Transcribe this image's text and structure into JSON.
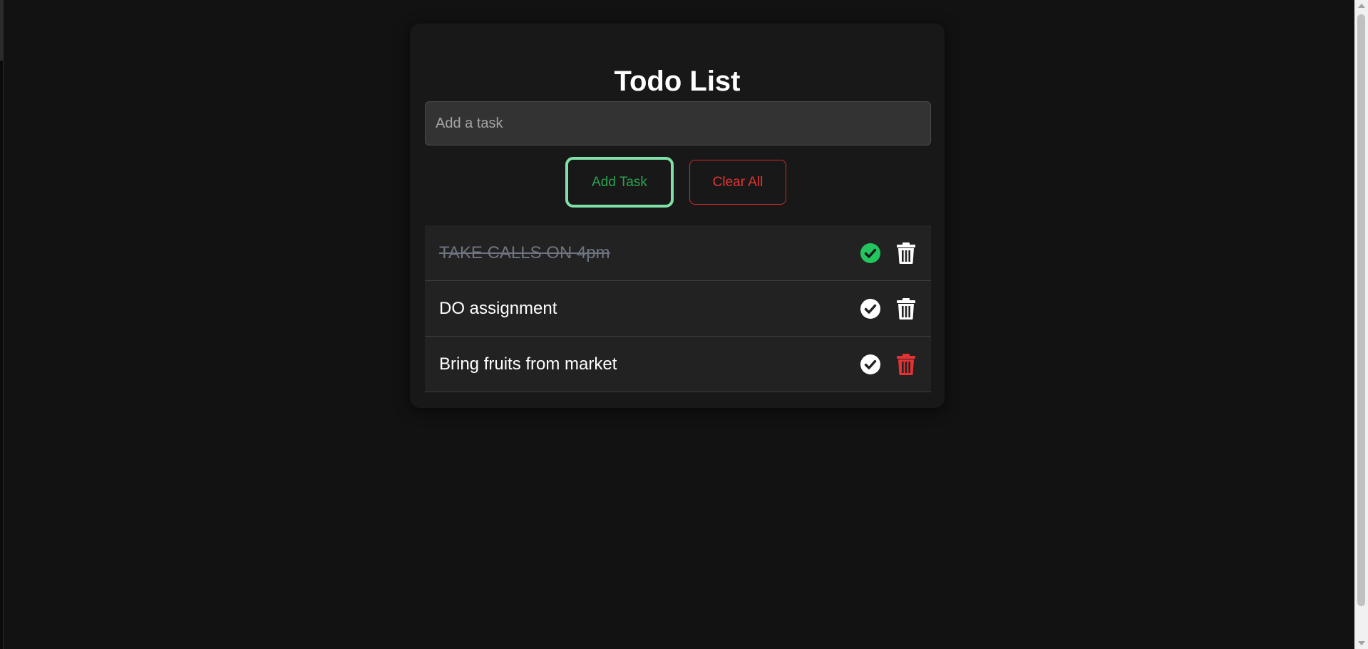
{
  "app": {
    "title": "Todo List"
  },
  "input": {
    "placeholder": "Add a task",
    "value": ""
  },
  "buttons": {
    "add_label": "Add Task",
    "clear_label": "Clear All"
  },
  "tasks": [
    {
      "text": "TAKE CALLS ON 4pm",
      "completed": true
    },
    {
      "text": "DO assignment",
      "completed": false
    },
    {
      "text": "Bring fruits from market",
      "completed": false
    }
  ],
  "icons": {
    "complete": "check-circle-icon",
    "delete": "trash-icon"
  },
  "colors": {
    "background": "#121212",
    "card": "#181818",
    "accent_green": "#22c55e",
    "accent_red": "#e53333",
    "focus_ring": "#7fe0a8"
  }
}
